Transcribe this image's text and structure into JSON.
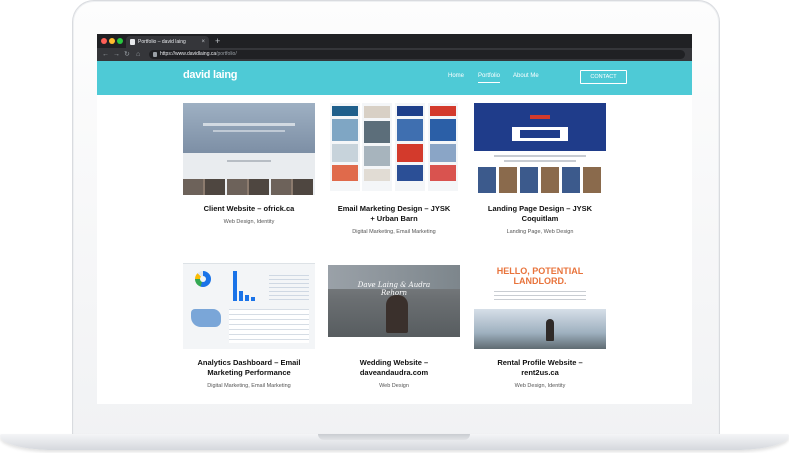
{
  "browser": {
    "tab_title": "Portfolio – david laing",
    "new_tab": "+",
    "url_host": "https://www.davidlaing.ca",
    "url_path": "/portfolio/"
  },
  "site": {
    "logo": "david laing",
    "nav": [
      {
        "label": "Home",
        "active": false
      },
      {
        "label": "Portfolio",
        "active": true
      },
      {
        "label": "About Me",
        "active": false
      }
    ],
    "contact_label": "CONTACT",
    "accent_color": "#4ecad6"
  },
  "projects": [
    {
      "title": "Client Website – ofrick.ca",
      "tags": "Web Design, Identity"
    },
    {
      "title": "Email Marketing Design – JYSK + Urban Barn",
      "tags": "Digital Marketing, Email Marketing"
    },
    {
      "title": "Landing Page Design – JYSK Coquitlam",
      "tags": "Landing Page, Web Design"
    },
    {
      "title": "Analytics Dashboard – Email Marketing Performance",
      "tags": "Digital Marketing, Email Marketing"
    },
    {
      "title": "Wedding Website – daveandaudra.com",
      "tags": "Web Design"
    },
    {
      "title": "Rental Profile Website – rent2us.ca",
      "tags": "Web Design, Identity"
    }
  ],
  "thumb_text": {
    "wedding_names": "Dave Laing & Audra Rehorn",
    "rental_heading": "HELLO, POTENTIAL LANDLORD."
  }
}
